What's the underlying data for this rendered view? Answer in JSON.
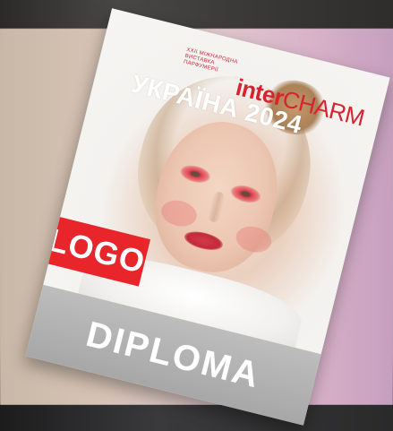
{
  "poster": {
    "tagline_lines": [
      "ХХІІ МІЖНАРОДНА",
      "ВИСТАВКА",
      "ПАРФУМЕРІЇ"
    ],
    "brand_bold": "inter",
    "brand_thin": "CHARM",
    "event_title": "УКРАЇНА 2024",
    "logo_label": "LOGO",
    "diploma_label": "DIPLOMA"
  },
  "colors": {
    "brand_red": "#d6232f",
    "logo_red": "#e8252b",
    "band_gray": "#a7a7a7"
  }
}
